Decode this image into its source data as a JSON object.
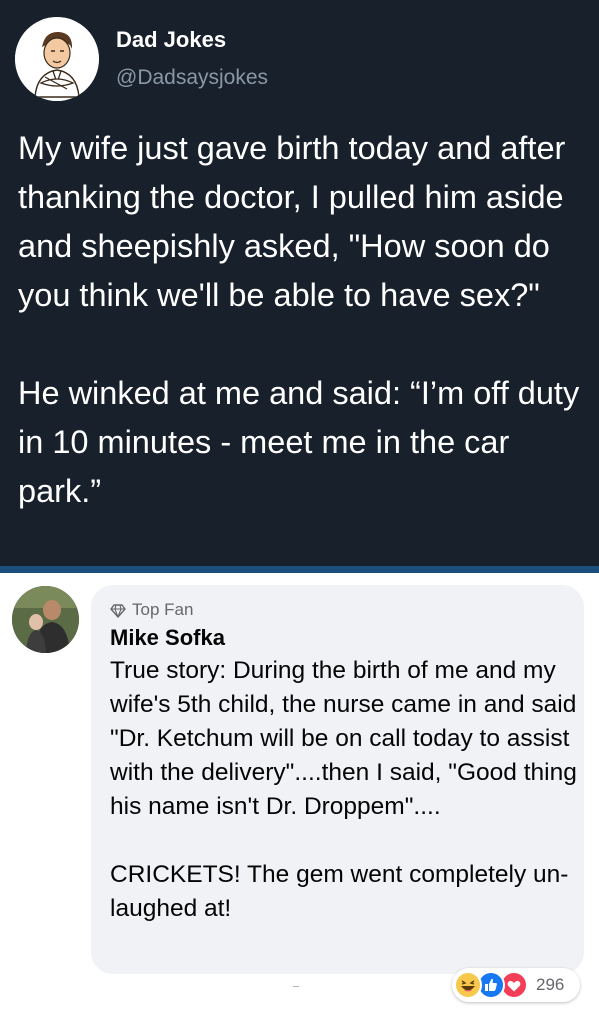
{
  "tweet": {
    "name": "Dad Jokes",
    "handle": "@Dadsaysjokes",
    "paragraphs": [
      "My wife just gave birth today and after thanking the doctor, I pulled him aside and sheepishly asked, \"How soon do you think we'll be able to have sex?\"",
      "He winked at me and said: “I’m off duty in 10 minutes - meet me in the car park.”"
    ],
    "avatar_icon": "cartoon-man-icon"
  },
  "comment": {
    "badge": "Top Fan",
    "badge_icon": "diamond-icon",
    "author": "Mike Sofka",
    "paragraphs": [
      "True story: During the birth of me and my wife's 5th child, the nurse came in and said \"Dr. Ketchum will be on call today to assist with the delivery\"....then I said, \"Good thing his name isn't Dr. Droppem\"....",
      "CRICKETS! The gem went completely un-laughed at!"
    ],
    "reactions": {
      "icons": [
        "haha-reaction-icon",
        "like-reaction-icon",
        "love-reaction-icon"
      ],
      "count": "296"
    }
  },
  "colors": {
    "tweet_bg": "#17202b",
    "divider": "#1d4f7d",
    "bubble_bg": "#f0f2f5",
    "like_blue": "#1877f2",
    "love_red": "#f33e58",
    "haha_yellow": "#f7c84b"
  }
}
